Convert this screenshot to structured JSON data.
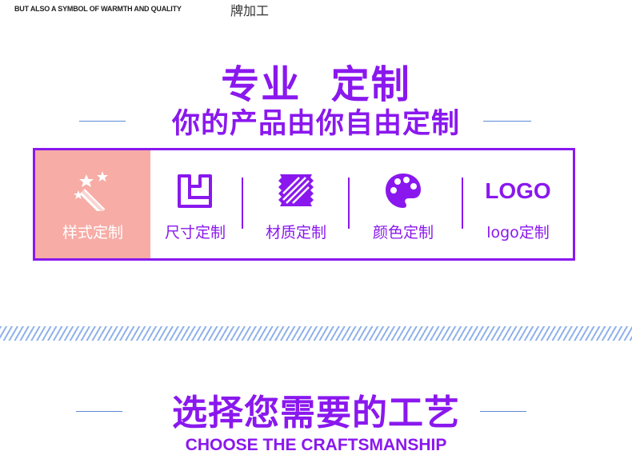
{
  "header": {
    "tagline": "BUT ALSO A SYMBOL OF WARMTH AND QUALITY",
    "cn_fragment": "牌加工"
  },
  "custom_section": {
    "title": "专业  定制",
    "subtitle": "你的产品由你自由定制",
    "options": [
      {
        "label": "样式定制",
        "icon": "magic-wand-icon",
        "active": true
      },
      {
        "label": "尺寸定制",
        "icon": "size-icon",
        "active": false
      },
      {
        "label": "材质定制",
        "icon": "fabric-icon",
        "active": false
      },
      {
        "label": "颜色定制",
        "icon": "palette-icon",
        "active": false
      },
      {
        "label": "logo定制",
        "icon": "logo-icon",
        "active": false,
        "icon_text": "LOGO"
      }
    ]
  },
  "craft_section": {
    "title": "选择您需要的工艺",
    "subtitle": "CHOOSE THE CRAFTSMANSHIP"
  },
  "colors": {
    "accent": "#8a18ee",
    "active_bg": "#f7aca6",
    "rule": "#5b8ad6",
    "stripe": "#8fb2ea"
  }
}
